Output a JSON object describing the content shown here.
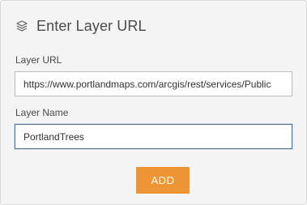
{
  "dialog": {
    "title": "Enter Layer URL",
    "icon": "layers-icon"
  },
  "layer_url": {
    "label": "Layer URL",
    "value": "https://www.portlandmaps.com/arcgis/rest/services/Public"
  },
  "layer_name": {
    "label": "Layer Name",
    "value": "PortlandTrees"
  },
  "add_button": {
    "label": "ADD",
    "color": "#ed9534"
  }
}
